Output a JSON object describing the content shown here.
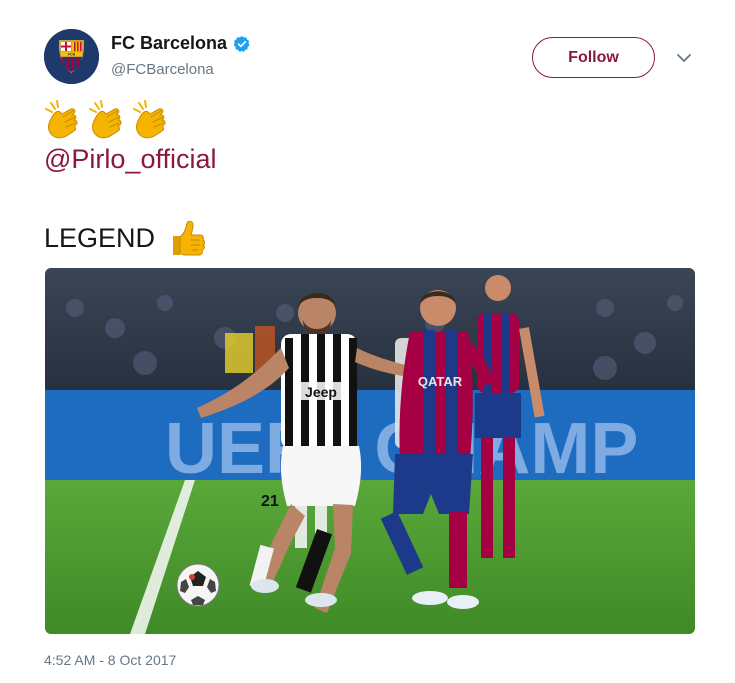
{
  "author": {
    "display_name": "FC Barcelona",
    "handle": "@FCBarcelona",
    "verified": true,
    "avatar_icon": "fc-barcelona-crest-icon",
    "crest_text": "FCB"
  },
  "actions": {
    "follow_label": "Follow",
    "menu_icon": "chevron-down-icon"
  },
  "tweet": {
    "emojis": [
      "clapping-hands-icon",
      "clapping-hands-icon",
      "clapping-hands-icon"
    ],
    "mention": "@Pirlo_official",
    "legend_text": "LEGEND",
    "legend_emoji": "thumbs-up-icon",
    "timestamp": "4:52 AM - 8 Oct 2017"
  },
  "media": {
    "board_text": "UEFA CHAMP",
    "shirt_sponsor_left": "Jeep",
    "shirt_number": "21",
    "shirt_sponsor_right": "QATAR"
  },
  "colors": {
    "brand": "#8b1a3a",
    "text": "#14171a",
    "muted": "#657786",
    "verified": "#1da1f2",
    "pitch": "#4f9a2f",
    "board": "#1e6cc0"
  }
}
